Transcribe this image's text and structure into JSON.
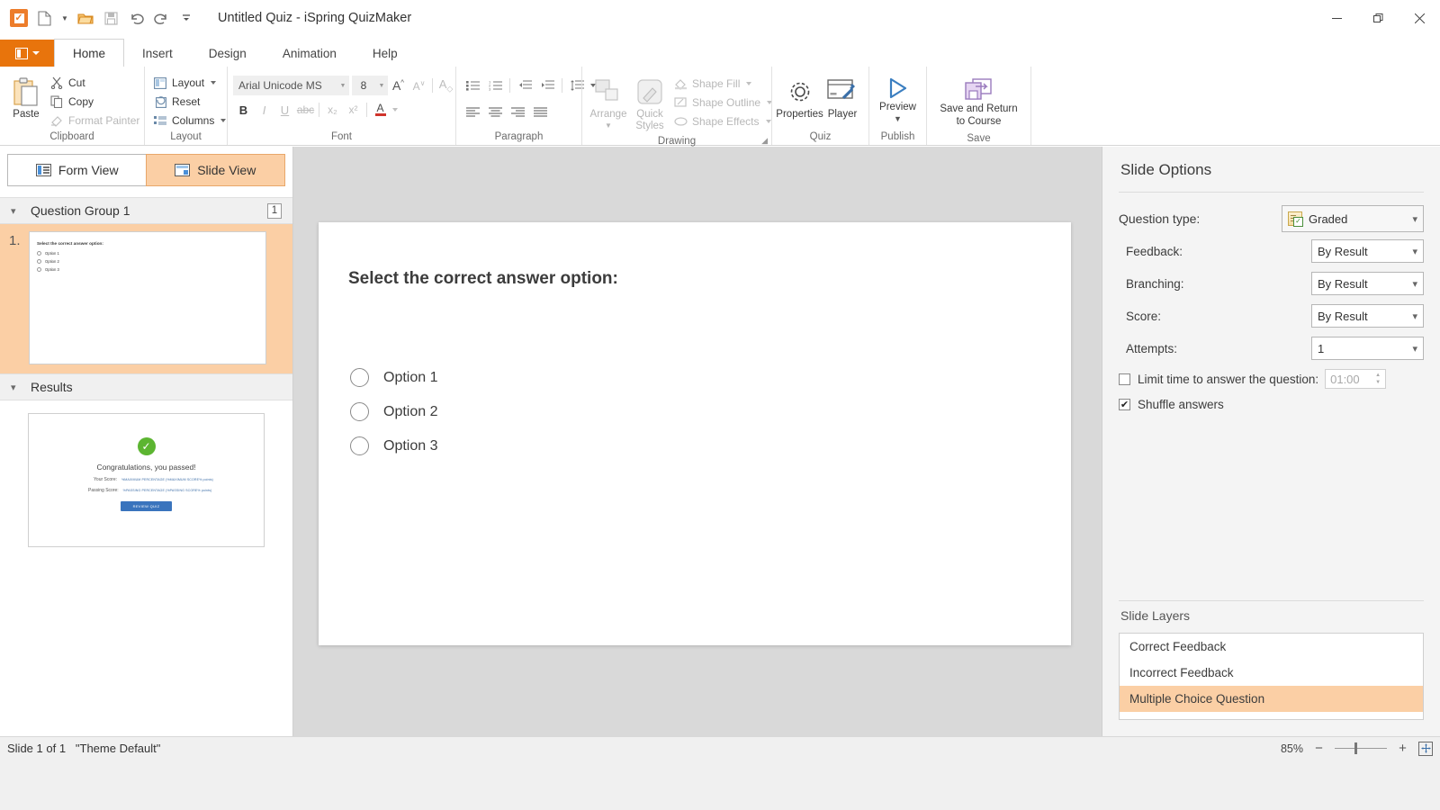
{
  "window": {
    "title": "Untitled Quiz - iSpring QuizMaker",
    "minimize_label": "—",
    "maximize_label": "❐",
    "close_label": "✕"
  },
  "quick_access": {
    "app_icon": "quizmaker-checkbox-icon",
    "items": [
      {
        "name": "new-document",
        "glyph": "🗋"
      },
      {
        "name": "new-dropdown",
        "glyph": "▾"
      },
      {
        "name": "open-folder",
        "glyph": "📂"
      },
      {
        "name": "save",
        "glyph": "💾"
      },
      {
        "name": "undo",
        "glyph": "↶"
      },
      {
        "name": "redo",
        "glyph": "↷"
      },
      {
        "name": "customize-qat",
        "glyph": "▼"
      }
    ]
  },
  "ribbon": {
    "file_menu_label": "",
    "tabs": [
      {
        "label": "Home",
        "active": true
      },
      {
        "label": "Insert",
        "active": false
      },
      {
        "label": "Design",
        "active": false
      },
      {
        "label": "Animation",
        "active": false
      },
      {
        "label": "Help",
        "active": false
      }
    ],
    "groups": {
      "clipboard": {
        "label": "Clipboard",
        "paste": "Paste",
        "cut": "Cut",
        "copy": "Copy",
        "format_painter": "Format Painter"
      },
      "layout": {
        "label": "Layout",
        "layout": "Layout",
        "reset": "Reset",
        "columns": "Columns"
      },
      "font": {
        "label": "Font",
        "font_name": "Arial Unicode MS",
        "font_size": "8",
        "grow_font": "A",
        "shrink_font": "A",
        "clear_formatting": "A",
        "bold": "B",
        "italic": "I",
        "underline": "U",
        "strikethrough": "abc",
        "subscript": "x₂",
        "superscript": "x²",
        "font_color": "A"
      },
      "paragraph": {
        "label": "Paragraph",
        "bullets": "bullets-icon",
        "numbering": "numbering-icon",
        "decrease_indent": "decrease-indent-icon",
        "increase_indent": "increase-indent-icon",
        "line_spacing": "line-spacing-icon",
        "align_left": "align-left-icon",
        "align_center": "align-center-icon",
        "align_right": "align-right-icon",
        "justify": "justify-icon"
      },
      "drawing": {
        "label": "Drawing",
        "arrange": "Arrange",
        "quick_styles": "Quick\nStyles",
        "quick_styles_line1": "Quick",
        "quick_styles_line2": "Styles",
        "shape_fill": "Shape Fill",
        "shape_outline": "Shape Outline",
        "shape_effects": "Shape Effects"
      },
      "quiz": {
        "label": "Quiz",
        "properties": "Properties",
        "player": "Player"
      },
      "publish": {
        "label": "Publish",
        "preview": "Preview"
      },
      "save": {
        "label": "Save",
        "save_return_line1": "Save and Return",
        "save_return_line2": "to Course"
      }
    }
  },
  "left_panel": {
    "view_tabs": [
      {
        "label": "Form View",
        "icon": "form-view-icon",
        "active": false
      },
      {
        "label": "Slide View",
        "icon": "slide-view-icon",
        "active": true
      }
    ],
    "question_group": {
      "title": "Question Group 1",
      "count": "1",
      "slide_number": "1.",
      "thumbnail": {
        "title": "Select the correct answer option:",
        "options": [
          "Option 1",
          "Option 2",
          "Option 3"
        ]
      }
    },
    "results": {
      "title": "Results",
      "thumbnail": {
        "check_glyph": "✓",
        "congrats": "Congratulations, you passed!",
        "your_score_label": "Your Score:",
        "your_score_value": "%MAXIMUM PERCENTAGE (%MAXIMUM SCORE% points)",
        "passing_score_label": "Passing Score:",
        "passing_score_value": "%PASSING PERCENTAGE (%PASSING SCORE% points)",
        "review_button": "REVIEW QUIZ"
      }
    }
  },
  "canvas": {
    "question_title": "Select the correct answer option:",
    "options": [
      "Option 1",
      "Option 2",
      "Option 3"
    ]
  },
  "right_panel": {
    "title": "Slide Options",
    "question_type_label": "Question type:",
    "question_type_value": "Graded",
    "feedback_label": "Feedback:",
    "feedback_value": "By Result",
    "branching_label": "Branching:",
    "branching_value": "By Result",
    "score_label": "Score:",
    "score_value": "By Result",
    "attempts_label": "Attempts:",
    "attempts_value": "1",
    "limit_time_label": "Limit time to answer the question:",
    "limit_time_value": "01:00",
    "limit_time_checked": false,
    "shuffle_label": "Shuffle answers",
    "shuffle_checked": true,
    "shuffle_check_glyph": "✔",
    "slide_layers_title": "Slide Layers",
    "slide_layers": [
      {
        "label": "Correct Feedback",
        "selected": false
      },
      {
        "label": "Incorrect Feedback",
        "selected": false
      },
      {
        "label": "Multiple Choice Question",
        "selected": true
      }
    ]
  },
  "status_bar": {
    "slide_info": "Slide 1 of 1",
    "theme_info": "\"Theme Default\"",
    "zoom_percent": "85%",
    "zoom_out": "−",
    "zoom_in": "+",
    "fit_label": "✥"
  },
  "colors": {
    "accent_orange": "#e8740c",
    "selection_orange": "#fbcfa5",
    "accent_blue": "#0078d7",
    "canvas_gray": "#d9d9d9"
  }
}
